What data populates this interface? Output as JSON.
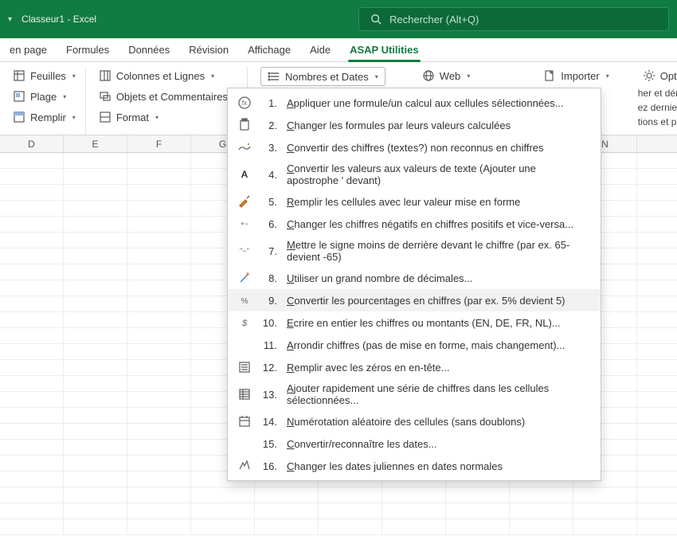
{
  "titlebar": {
    "title": "Classeur1  -  Excel",
    "search_placeholder": "Rechercher (Alt+Q)"
  },
  "tabs": {
    "items": [
      {
        "label": "en page"
      },
      {
        "label": "Formules"
      },
      {
        "label": "Données"
      },
      {
        "label": "Révision"
      },
      {
        "label": "Affichage"
      },
      {
        "label": "Aide"
      },
      {
        "label": "ASAP Utilities"
      }
    ],
    "active_index": 6
  },
  "ribbon": {
    "feuilles": "Feuilles",
    "plage": "Plage",
    "remplir": "Remplir",
    "colonnes_lignes": "Colonnes et Lignes",
    "objets_commentaires": "Objets et Commentaires",
    "format": "Format",
    "nombres_dates": "Nombres et Dates",
    "web": "Web",
    "importer": "Importer",
    "options": "Options ASAP Utilities",
    "extra1": "her et démarrer un",
    "extra2": "ez dernier outil",
    "extra3": "tions et paramètre"
  },
  "columns": [
    "D",
    "E",
    "F",
    "G",
    "",
    "",
    "",
    "",
    "",
    "N"
  ],
  "menu": {
    "items": [
      {
        "num": "1.",
        "u": "A",
        "rest": "ppliquer une formule/un calcul aux cellules sélectionnées...",
        "icon": "fx"
      },
      {
        "num": "2.",
        "u": "C",
        "rest": "hanger les formules par leurs valeurs calculées",
        "icon": "paste"
      },
      {
        "num": "3.",
        "u": "C",
        "rest": "onvertir des chiffres (textes?) non reconnus en chiffres",
        "icon": "wave"
      },
      {
        "num": "4.",
        "u": "C",
        "rest": "onvertir les valeurs aux valeurs de texte (Ajouter une apostrophe ' devant)",
        "icon": "A"
      },
      {
        "num": "5.",
        "u": "R",
        "rest": "emplir les cellules avec leur valeur mise en forme",
        "icon": "brush"
      },
      {
        "num": "6.",
        "u": "C",
        "rest": "hanger les chiffres négatifs en chiffres positifs et vice-versa...",
        "icon": "pm"
      },
      {
        "num": "7.",
        "u": "M",
        "rest": "ettre le signe moins de derrière devant le chiffre (par ex. 65- devient -65)",
        "icon": "minus"
      },
      {
        "num": "8.",
        "u": "U",
        "rest": "tiliser un grand nombre de décimales...",
        "icon": "wand"
      },
      {
        "num": "9.",
        "u": "C",
        "rest": "onvertir les pourcentages en chiffres (par ex. 5% devient 5)",
        "icon": "percent",
        "hover": true
      },
      {
        "num": "10.",
        "u": "E",
        "rest": "crire en entier les chiffres ou montants (EN, DE, FR, NL)...",
        "icon": "dollar"
      },
      {
        "num": "11.",
        "u": "A",
        "rest": "rrondir chiffres (pas de mise en forme, mais changement)...",
        "icon": ""
      },
      {
        "num": "12.",
        "u": "R",
        "rest": "emplir avec les zéros en en-tête...",
        "icon": "list"
      },
      {
        "num": "13.",
        "u": "A",
        "rest": "jouter rapidement une série de chiffres dans les cellules sélectionnées...",
        "icon": "listnum"
      },
      {
        "num": "14.",
        "u": "N",
        "rest": "umérotation aléatoire des cellules (sans doublons)",
        "icon": "cal"
      },
      {
        "num": "15.",
        "u": "C",
        "rest": "onvertir/reconnaître les dates...",
        "icon": ""
      },
      {
        "num": "16.",
        "u": "C",
        "rest": "hanger les dates juliennes en dates normales",
        "icon": "jd"
      }
    ]
  }
}
